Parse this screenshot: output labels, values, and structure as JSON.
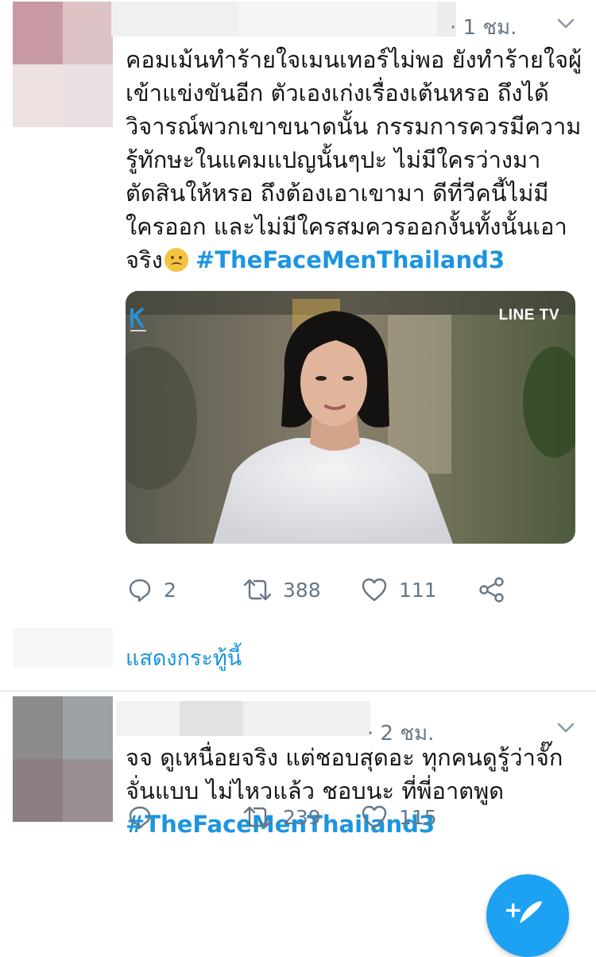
{
  "tweets": [
    {
      "timestamp": "· 1 ชม.",
      "text": "คอมเม้นทำร้ายใจเมนเทอร์ไม่พอ ยังทำร้ายใจผู้เข้าแข่งขันอีก ตัวเองเก่งเรื่องเต้นหรอ ถึงได้วิจารณ์พวกเขาขนาดนั้น กรรมการควรมีความรู้ทักษะในแคมแปญนั้นๆปะ ไม่มีใครว่างมาตัดสินให้หรอ ถึงต้องเอาเขามา ดีที่วีคนี้ไม่มีใครออก และไม่มีใครสมควรออกงั้นทั้งนั้นเอาจริง",
      "emoji": "woozy-face",
      "hashtag": "#TheFaceMenThailand3",
      "media": {
        "watermark": "LINE TV",
        "brand_icon": "kantana-logo-icon"
      },
      "replies": "2",
      "retweets": "388",
      "likes": "111",
      "show_thread": "แสดงกระทู้นี้"
    },
    {
      "timestamp": "· 2 ชม.",
      "text": "จจ ดูเหนื่อยจริง แต่ชอบสุดอะ ทุกคนดูรู้ว่าจั๊กจั่นแบบ ไม่ไหวแล้ว ชอบนะ ที่พี่อาตพูด",
      "hashtag": "#TheFaceMenThailand3",
      "retweets": "239",
      "likes": "115"
    }
  ],
  "colors": {
    "accent": "#1b95e0",
    "muted": "#657786",
    "fab": "#1da1f2"
  },
  "fab": {
    "icon": "compose-tweet-icon",
    "plus": "+"
  }
}
